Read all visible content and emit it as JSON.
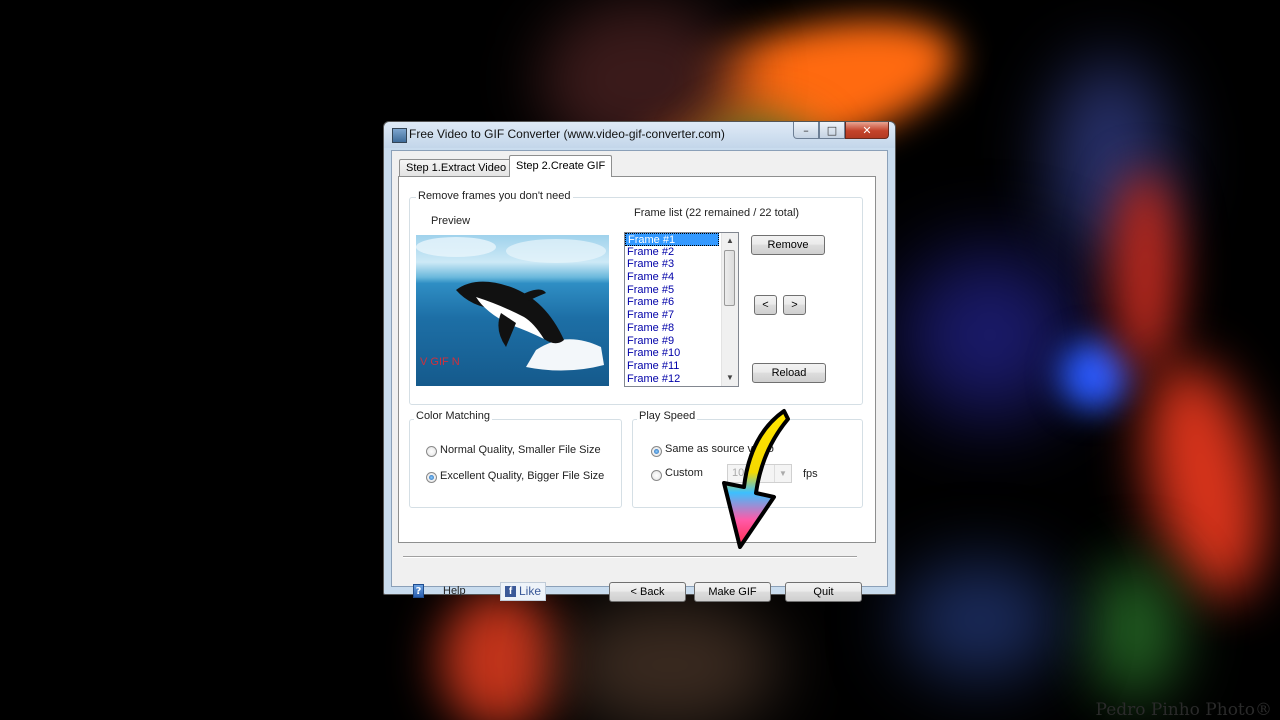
{
  "window": {
    "title": "Free Video to GIF Converter (www.video-gif-converter.com)"
  },
  "tabs": [
    {
      "label": "Step 1.Extract Video",
      "active": false
    },
    {
      "label": "Step 2.Create GIF",
      "active": true
    }
  ],
  "remove_frames": {
    "group_label": "Remove frames you don't need",
    "preview_label": "Preview",
    "frame_list_label": "Frame list (22 remained / 22 total)",
    "frames": [
      "Frame #1",
      "Frame #2",
      "Frame #3",
      "Frame #4",
      "Frame #5",
      "Frame #6",
      "Frame #7",
      "Frame #8",
      "Frame #9",
      "Frame #10",
      "Frame #11",
      "Frame #12"
    ],
    "selected_frame": "Frame #1",
    "remove_label": "Remove",
    "prev_label": "<",
    "next_label": ">",
    "reload_label": "Reload"
  },
  "color_matching": {
    "group_label": "Color Matching",
    "options": [
      "Normal Quality, Smaller File Size",
      "Excellent Quality, Bigger File Size"
    ],
    "selected": "Excellent Quality, Bigger File Size"
  },
  "play_speed": {
    "group_label": "Play Speed",
    "same_label": "Same as source video",
    "custom_label": "Custom",
    "selected": "Same as source video",
    "fps_value": "10",
    "fps_unit": "fps"
  },
  "footer": {
    "help_label": "Help",
    "like_label": "Like",
    "back_label": "< Back",
    "make_gif_label": "Make GIF",
    "quit_label": "Quit"
  },
  "icons": {
    "help": "help-book-icon",
    "facebook": "facebook-icon",
    "pointer": "pointer-arrow-icon"
  },
  "watermark": "Pedro Pinho Photo®"
}
